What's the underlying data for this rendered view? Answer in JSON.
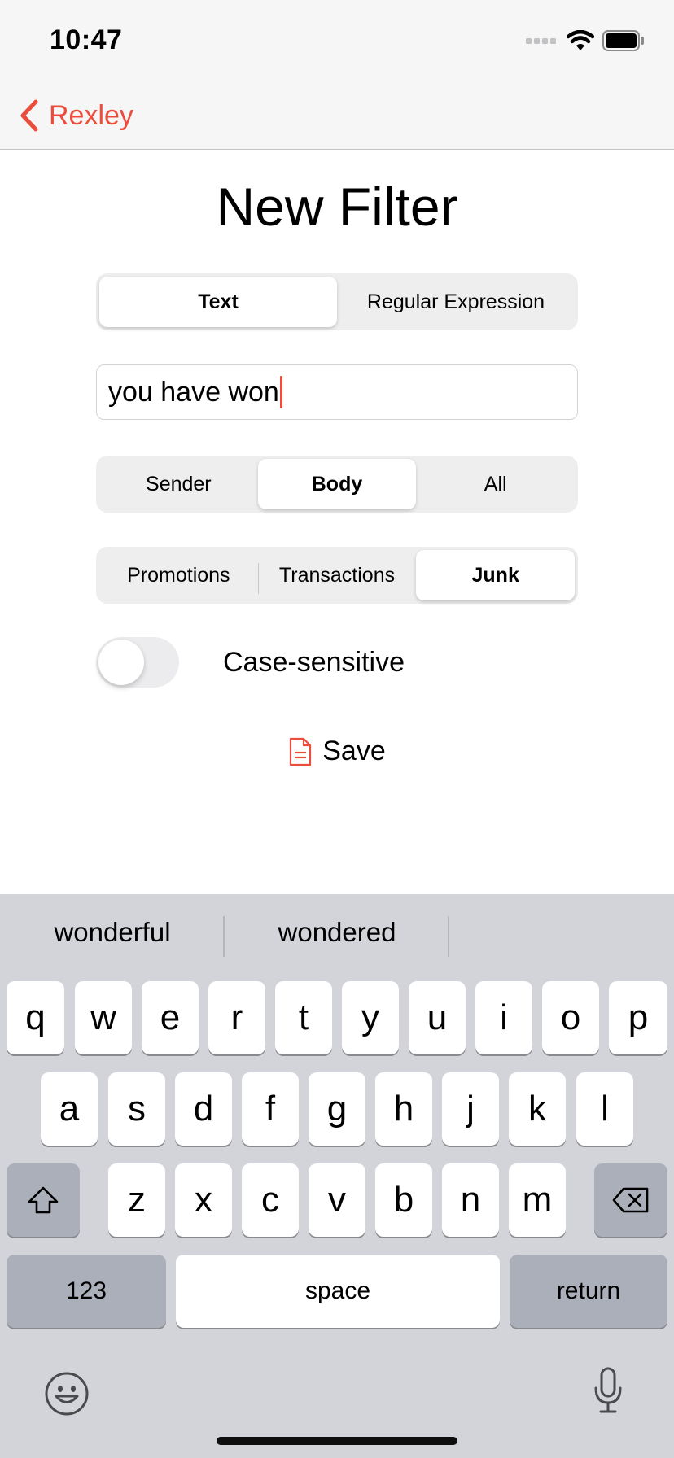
{
  "status_bar": {
    "time": "10:47"
  },
  "nav": {
    "back_label": "Rexley"
  },
  "page": {
    "title": "New Filter"
  },
  "match_type": {
    "options": [
      "Text",
      "Regular Expression"
    ],
    "selected": "Text"
  },
  "filter_text": {
    "value": "you have won"
  },
  "match_field": {
    "options": [
      "Sender",
      "Body",
      "All"
    ],
    "selected": "Body"
  },
  "category": {
    "options": [
      "Promotions",
      "Transactions",
      "Junk"
    ],
    "selected": "Junk"
  },
  "case_sensitive": {
    "label": "Case-sensitive",
    "on": false
  },
  "save": {
    "label": "Save"
  },
  "keyboard": {
    "suggestions": [
      "wonderful",
      "wondered",
      ""
    ],
    "rows": [
      [
        "q",
        "w",
        "e",
        "r",
        "t",
        "y",
        "u",
        "i",
        "o",
        "p"
      ],
      [
        "a",
        "s",
        "d",
        "f",
        "g",
        "h",
        "j",
        "k",
        "l"
      ],
      [
        "z",
        "x",
        "c",
        "v",
        "b",
        "n",
        "m"
      ]
    ],
    "numbers_label": "123",
    "space_label": "space",
    "return_label": "return"
  },
  "colors": {
    "accent": "#eb4d3d",
    "keyboard_bg": "#d2d4da",
    "function_key": "#abafb9"
  }
}
